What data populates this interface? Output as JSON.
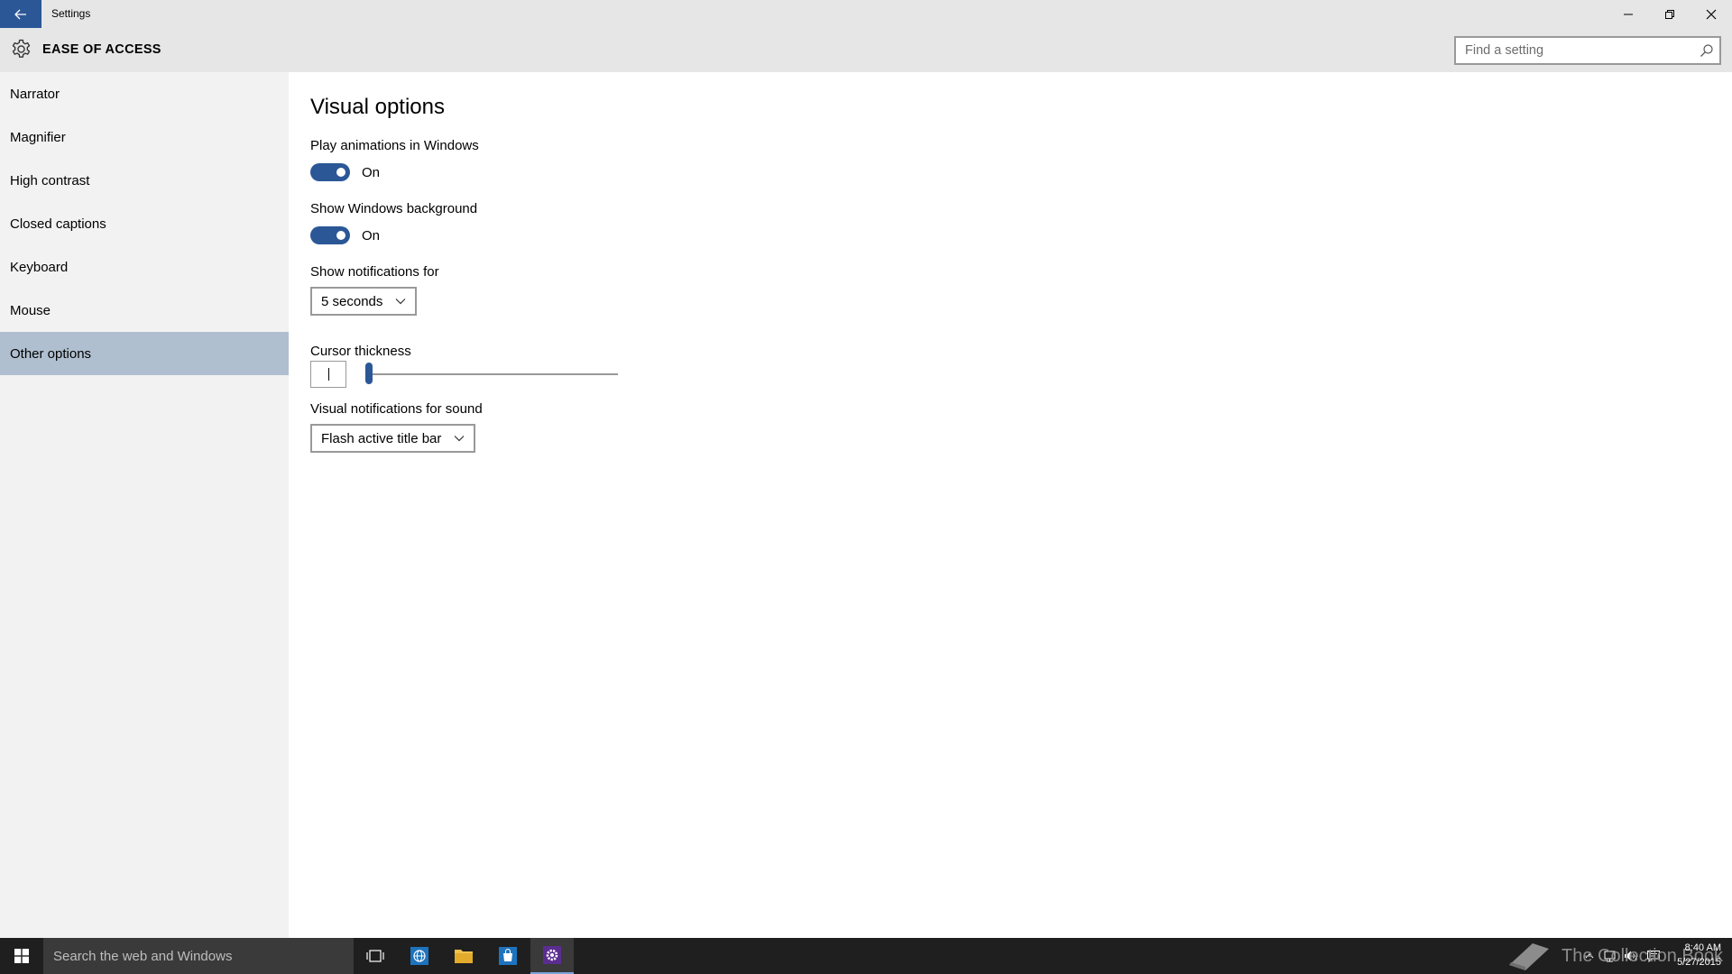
{
  "titlebar": {
    "app_title": "Settings",
    "back_icon": "arrow-left-icon",
    "minimize_icon": "minimize-icon",
    "maximize_icon": "restore-icon",
    "close_icon": "close-icon"
  },
  "header": {
    "title": "EASE OF ACCESS",
    "icon": "gear-icon",
    "search": {
      "placeholder": "Find a setting",
      "value": ""
    }
  },
  "sidebar": {
    "items": [
      {
        "label": "Narrator",
        "selected": false
      },
      {
        "label": "Magnifier",
        "selected": false
      },
      {
        "label": "High contrast",
        "selected": false
      },
      {
        "label": "Closed captions",
        "selected": false
      },
      {
        "label": "Keyboard",
        "selected": false
      },
      {
        "label": "Mouse",
        "selected": false
      },
      {
        "label": "Other options",
        "selected": true
      }
    ]
  },
  "main": {
    "title": "Visual options",
    "play_animations": {
      "label": "Play animations in Windows",
      "state": "On"
    },
    "show_background": {
      "label": "Show Windows background",
      "state": "On"
    },
    "notifications": {
      "label": "Show notifications for",
      "selected": "5 seconds"
    },
    "cursor_thickness": {
      "label": "Cursor thickness",
      "value": 1,
      "min": 1,
      "max": 20
    },
    "visual_sound": {
      "label": "Visual notifications for sound",
      "selected": "Flash active title bar"
    }
  },
  "taskbar": {
    "search_placeholder": "Search the web and Windows",
    "watermark": "The Collection Book",
    "time": "8:40 AM",
    "date": "5/27/2015"
  },
  "colors": {
    "accent": "#2b5797",
    "selected_nav": "#b0bfcf",
    "header_bg": "#e6e6e6",
    "sidebar_bg": "#f2f2f2",
    "taskbar_bg": "#1f1f1f"
  }
}
